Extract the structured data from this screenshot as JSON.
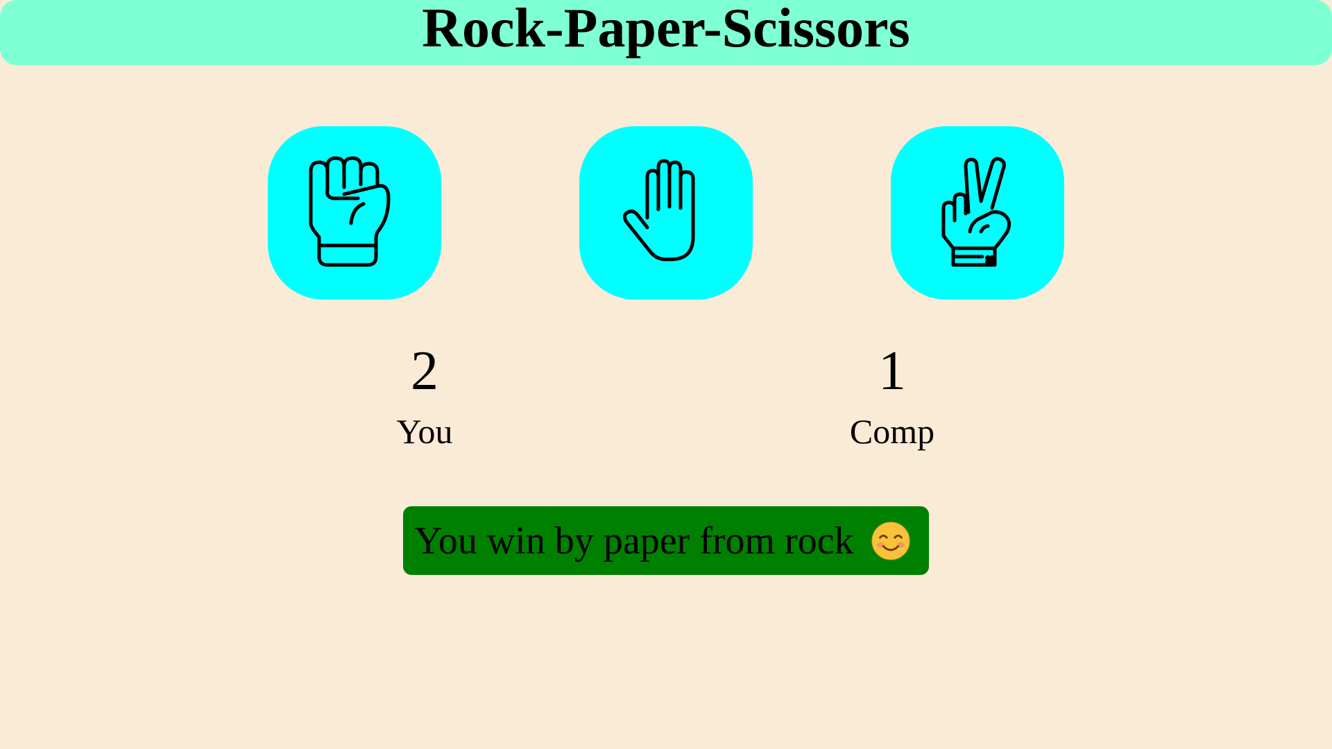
{
  "title": "Rock-Paper-Scissors",
  "choices": [
    {
      "id": "rock",
      "icon": "fist-icon"
    },
    {
      "id": "paper",
      "icon": "open-hand-icon"
    },
    {
      "id": "scissors",
      "icon": "peace-hand-icon"
    }
  ],
  "scores": {
    "user": {
      "value": "2",
      "label": "You"
    },
    "comp": {
      "value": "1",
      "label": "Comp"
    }
  },
  "message": {
    "text": "You win by paper from rock",
    "icon": "smiling-face-icon",
    "bg_color": "#008000"
  },
  "colors": {
    "background": "#faebd7",
    "header": "#7fffd4",
    "choice": "#00ffff"
  }
}
